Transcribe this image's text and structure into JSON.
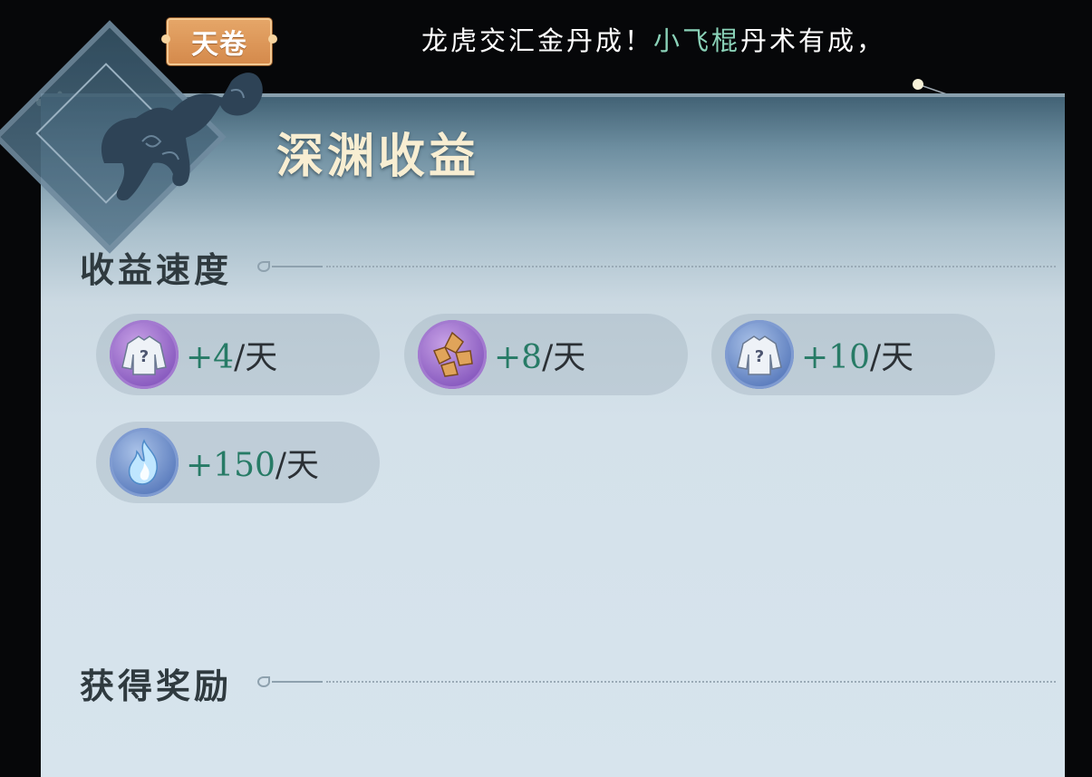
{
  "top": {
    "tag_label": "天卷",
    "banner": {
      "prefix": "龙虎交汇金丹成！",
      "player": "小飞棍",
      "suffix": "丹术有成，"
    }
  },
  "panel": {
    "title": "深渊收益",
    "sections": {
      "speed": {
        "heading": "收益速度"
      },
      "rewards": {
        "heading": "获得奖励"
      }
    },
    "rates": [
      {
        "icon": "mystery-robe-icon",
        "value": "+4",
        "unit": "/天",
        "frame_color": "#8a5cc0"
      },
      {
        "icon": "gold-ore-icon",
        "value": "+8",
        "unit": "/天",
        "frame_color": "#8a5cc0"
      },
      {
        "icon": "mystery-robe-icon",
        "value": "+10",
        "unit": "/天",
        "frame_color": "#5e7fbf"
      },
      {
        "icon": "blue-flame-icon",
        "value": "+150",
        "unit": "/天",
        "frame_color": "#5e7fbf"
      }
    ]
  },
  "colors": {
    "accent_value": "#277b66",
    "banner_highlight": "#8ad2b8",
    "tag_bg": "#d4894b"
  }
}
